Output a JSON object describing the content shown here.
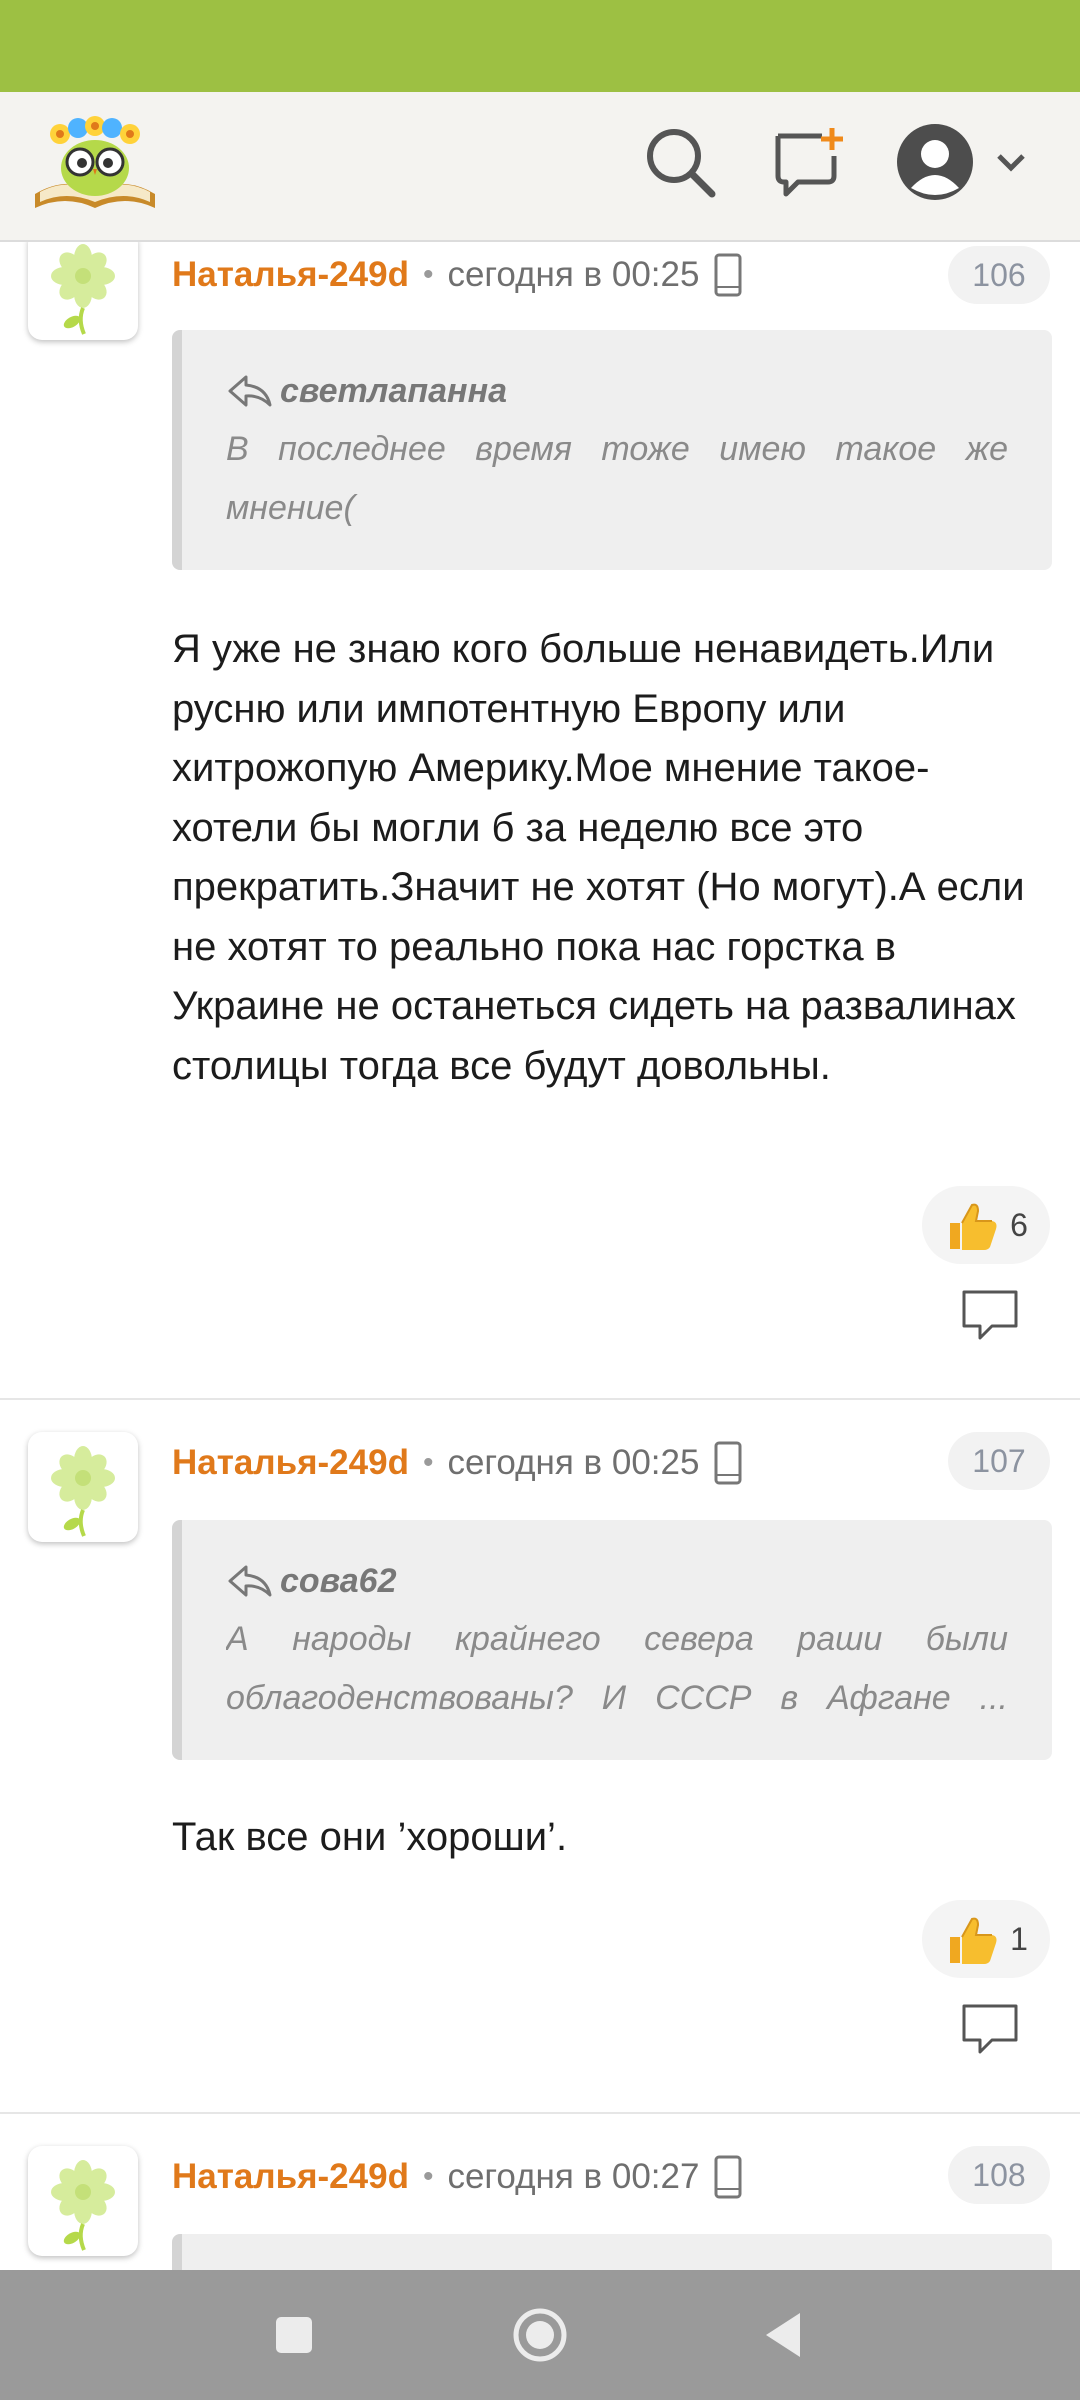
{
  "header": {
    "logo": "book-owl-logo-icon",
    "search": "search-icon",
    "new_topic": "new-topic-icon",
    "profile": "user-avatar-icon"
  },
  "comments": [
    {
      "author": "Наталья-249d",
      "time": "сегодня в 00:25",
      "number": "106",
      "quote_author": "светлапанна",
      "quote_text": "В последнее время тоже имею такое же мнение(",
      "text": "Я уже не знаю кого больше ненавидеть.Или русню или импотентную Европу или хитрожопую Америку.Мое мнение такое-хотели бы могли б за неделю все это прекратить.Значит не хотят (Но могут).А если не хотят то реально пока нас горстка в Украине не останеться сидеть на развалинах столицы тогда все будут довольны.",
      "likes": "6"
    },
    {
      "author": "Наталья-249d",
      "time": "сегодня в 00:25",
      "number": "107",
      "quote_author": "сова62",
      "quote_text": "А народы крайнего севера раши были облагоденствованы? И СССР в Афгане ...",
      "text": "Так все они ’хороши’.",
      "likes": "1"
    },
    {
      "author": "Наталья-249d",
      "time": "сегодня в 00:27",
      "number": "108"
    }
  ],
  "colors": {
    "status_bar": "#9dc043",
    "author": "#e0791a",
    "nav_bar": "#9a9a9a"
  }
}
